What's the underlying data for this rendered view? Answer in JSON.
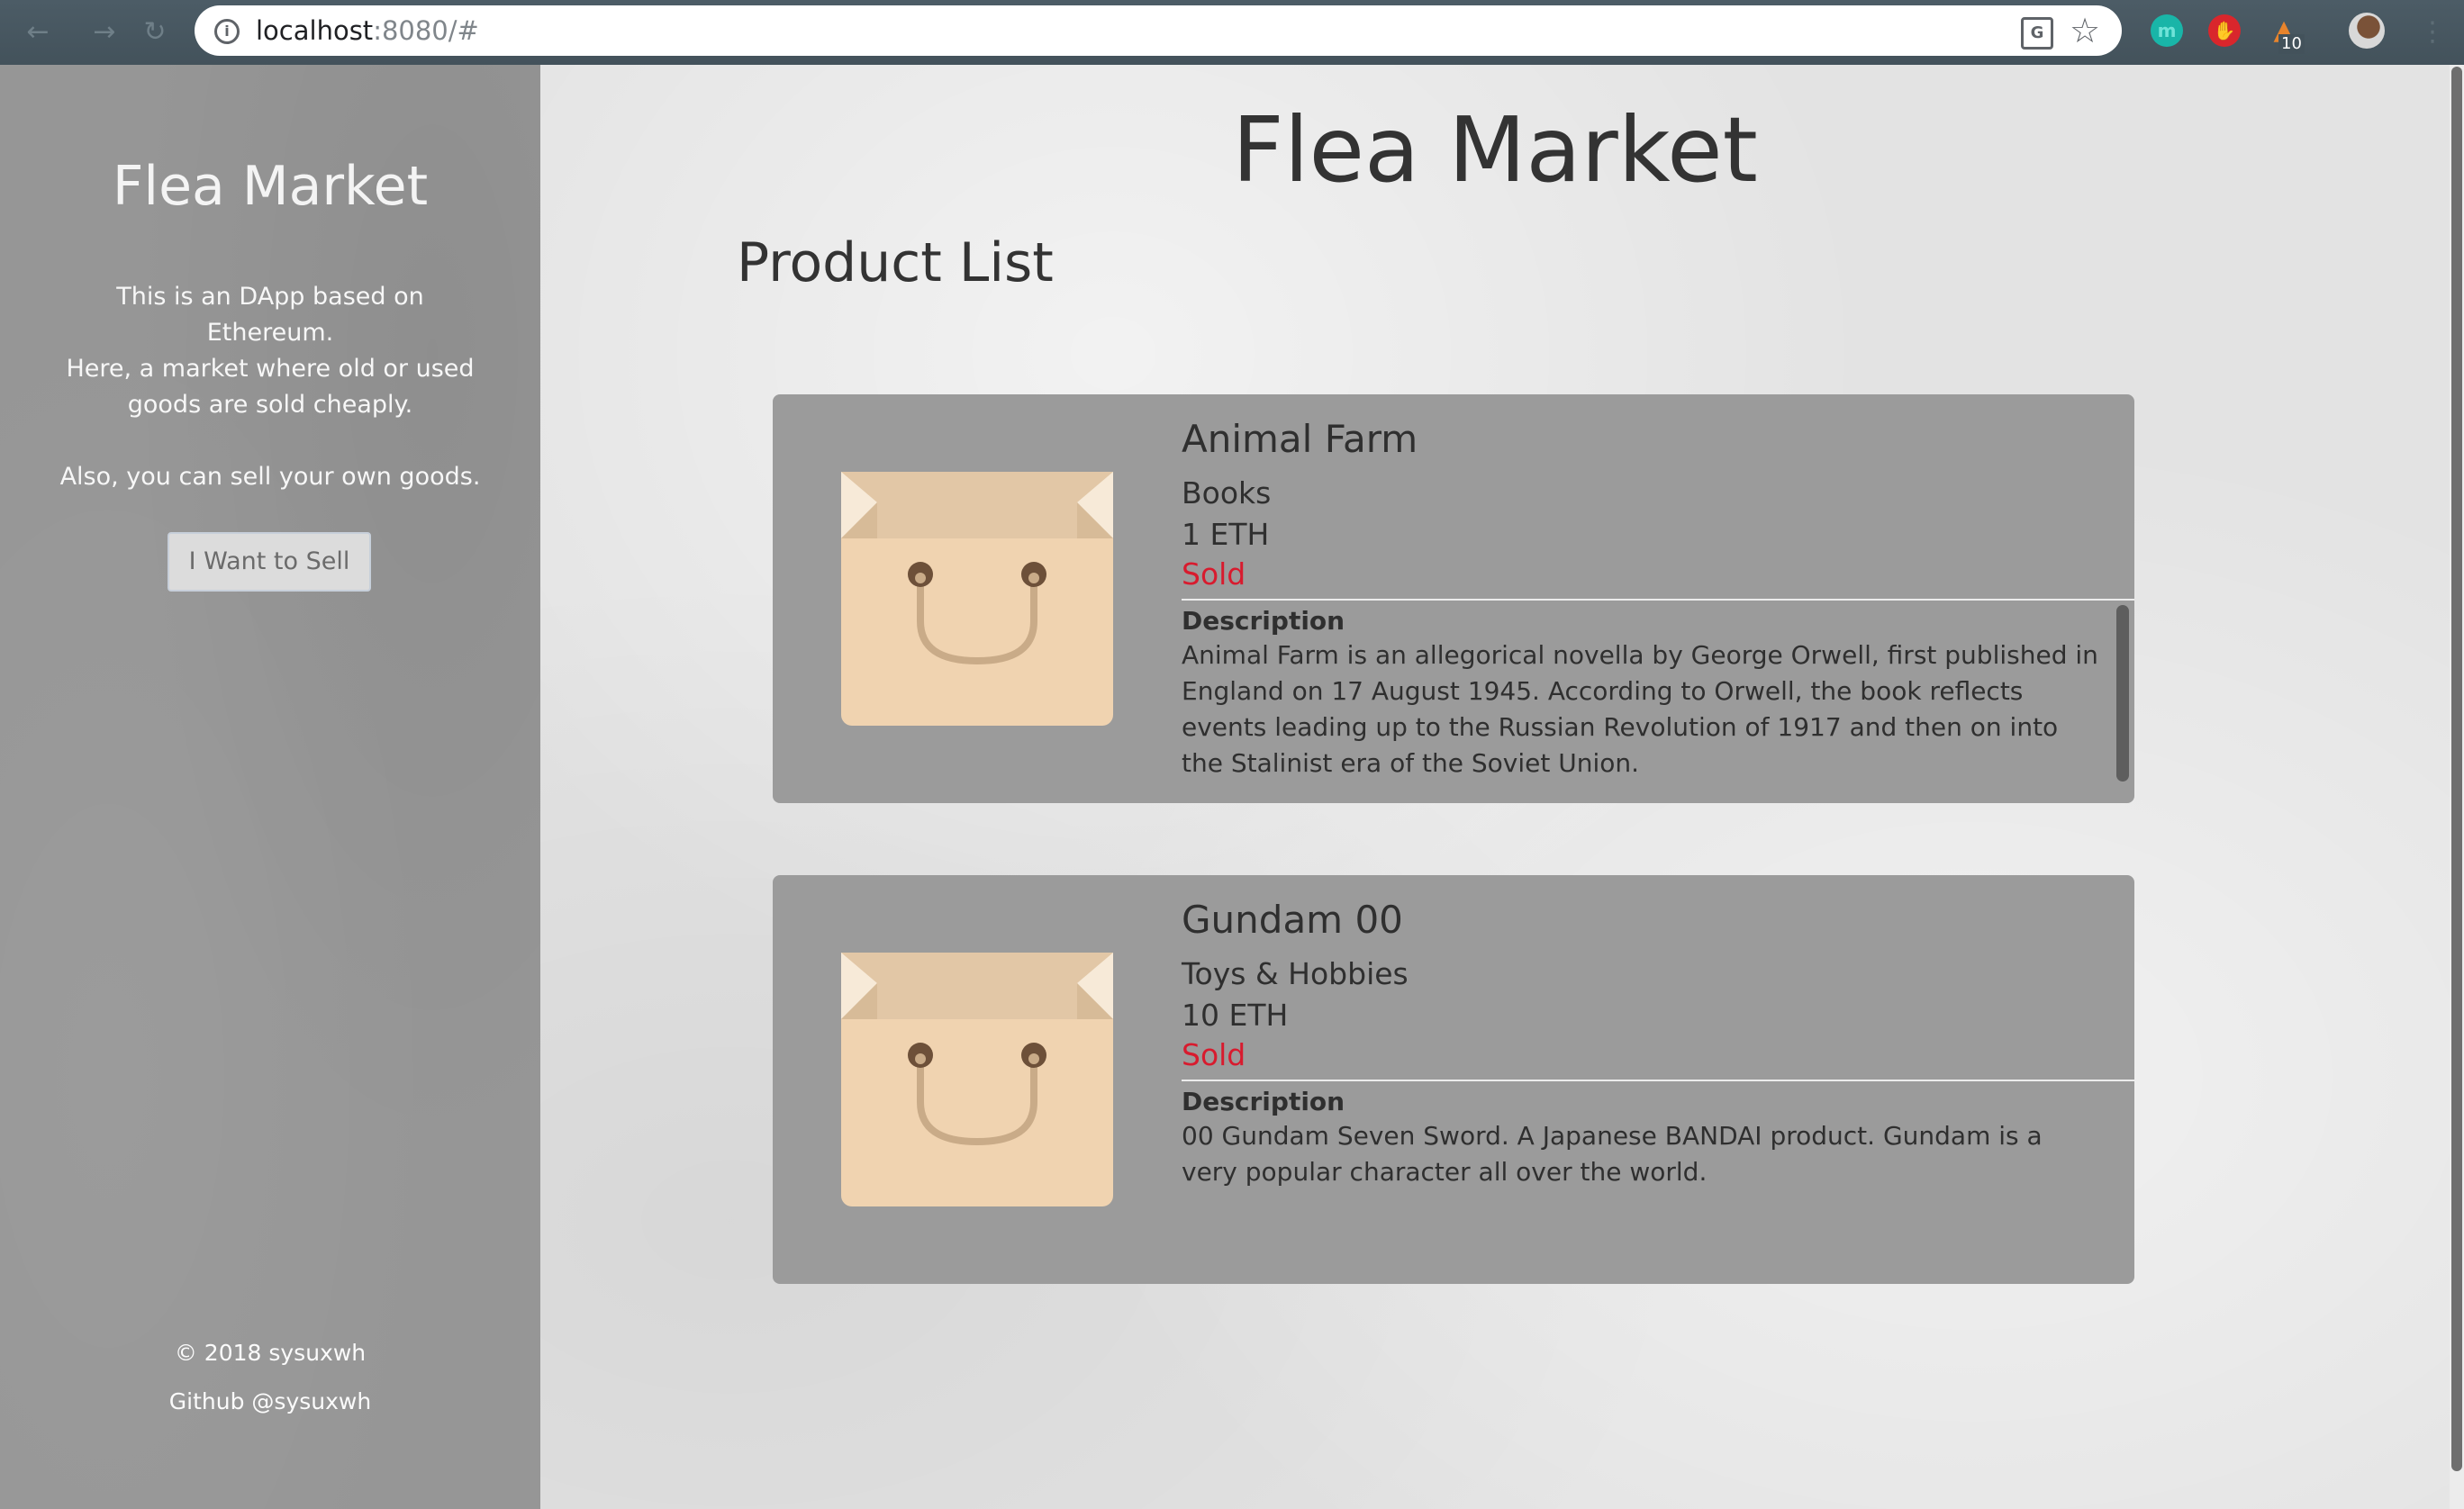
{
  "browser": {
    "url_host": "localhost",
    "url_rest": ":8080/#",
    "extension_badge": "10"
  },
  "sidebar": {
    "title": "Flea Market",
    "intro": "This is an DApp based on Ethereum.",
    "market_text": "Here, a market where old or used goods are sold cheaply.",
    "sell_text": "Also, you can sell your own goods.",
    "sell_button": "I Want to Sell",
    "copyright": "© 2018 sysuxwh",
    "github": "Github @sysuxwh"
  },
  "main": {
    "title": "Flea Market",
    "section_title": "Product List",
    "description_label": "Description",
    "products": [
      {
        "name": "Animal Farm",
        "category": "Books",
        "price": "1 ETH",
        "status": "Sold",
        "description": "Animal Farm is an allegorical novella by George Orwell, first published in England on 17 August 1945. According to Orwell, the book reflects events leading up to the Russian Revolution of 1917 and then on into the Stalinist era of the Soviet Union."
      },
      {
        "name": "Gundam 00",
        "category": "Toys & Hobbies",
        "price": "10 ETH",
        "status": "Sold",
        "description": "00 Gundam Seven Sword. A Japanese BANDAI product. Gundam is a very popular character all over the world."
      }
    ]
  },
  "colors": {
    "sidebar_bg": "#969696",
    "card_bg": "#9b9b9b",
    "sold_status": "#d81b2e",
    "bag_body": "#f0d3b0",
    "bag_top": "#e2c7a6"
  },
  "icons": {
    "product_image": "shopping-bag-icon",
    "back": "arrow-left-icon",
    "forward": "arrow-right-icon",
    "reload": "reload-icon",
    "info": "info-icon",
    "translate": "translate-icon",
    "bookmark": "star-icon"
  }
}
